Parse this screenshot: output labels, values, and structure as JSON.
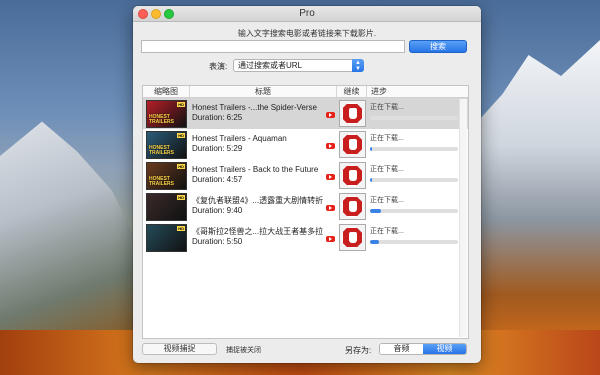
{
  "window": {
    "title": "Pro"
  },
  "instruction": "输入文字搜索电影或者链接来下载影片.",
  "search": {
    "placeholder": "",
    "value": "",
    "button_label": "搜索"
  },
  "source": {
    "label": "表演:",
    "selected": "通过搜索或者URL"
  },
  "table": {
    "columns": {
      "thumb": "缩略图",
      "title": "标题",
      "resume": "继续",
      "progress": "进步"
    },
    "rows": [
      {
        "thumb_text": "HONEST TRAILERS",
        "thumb_badge": "HD",
        "thumb_color": "#b51f28",
        "name": "Honest Trailers -...the Spider-Verse",
        "duration": "Duration: 6:25",
        "status": "正在下载...",
        "progress": 0.0,
        "selected": true
      },
      {
        "thumb_text": "HONEST TRAILERS",
        "thumb_badge": "HD",
        "thumb_color": "#2b5d7a",
        "name": "Honest Trailers - Aquaman",
        "duration": "Duration: 5:29",
        "status": "正在下载...",
        "progress": 0.02,
        "selected": false
      },
      {
        "thumb_text": "HONEST TRAILERS",
        "thumb_badge": "HD",
        "thumb_color": "#6a3b1f",
        "name": "Honest Trailers - Back to the Future",
        "duration": "Duration: 4:57",
        "status": "正在下载...",
        "progress": 0.02,
        "selected": false
      },
      {
        "thumb_text": "",
        "thumb_badge": "HD",
        "thumb_color": "#3b2a2a",
        "name": "《复仇者联盟4》...透露重大剧情转折",
        "duration": "Duration: 9:40",
        "status": "正在下载...",
        "progress": 0.12,
        "selected": false
      },
      {
        "thumb_text": "",
        "thumb_badge": "HD",
        "thumb_color": "#244c5a",
        "name": "《哥斯拉2怪兽之...拉大战王者基多拉",
        "duration": "Duration: 5:50",
        "status": "正在下载...",
        "progress": 0.1,
        "selected": false
      }
    ]
  },
  "footer": {
    "capture_button": "视频捕捉",
    "capture_status": "捕捉被关闭",
    "save_as_label": "另存为:",
    "save_options": [
      "音频",
      "视频"
    ],
    "save_selected": "视频"
  },
  "colors": {
    "accent": "#2774e6",
    "stop_sign": "#c81e1e",
    "youtube": "#e62117"
  }
}
